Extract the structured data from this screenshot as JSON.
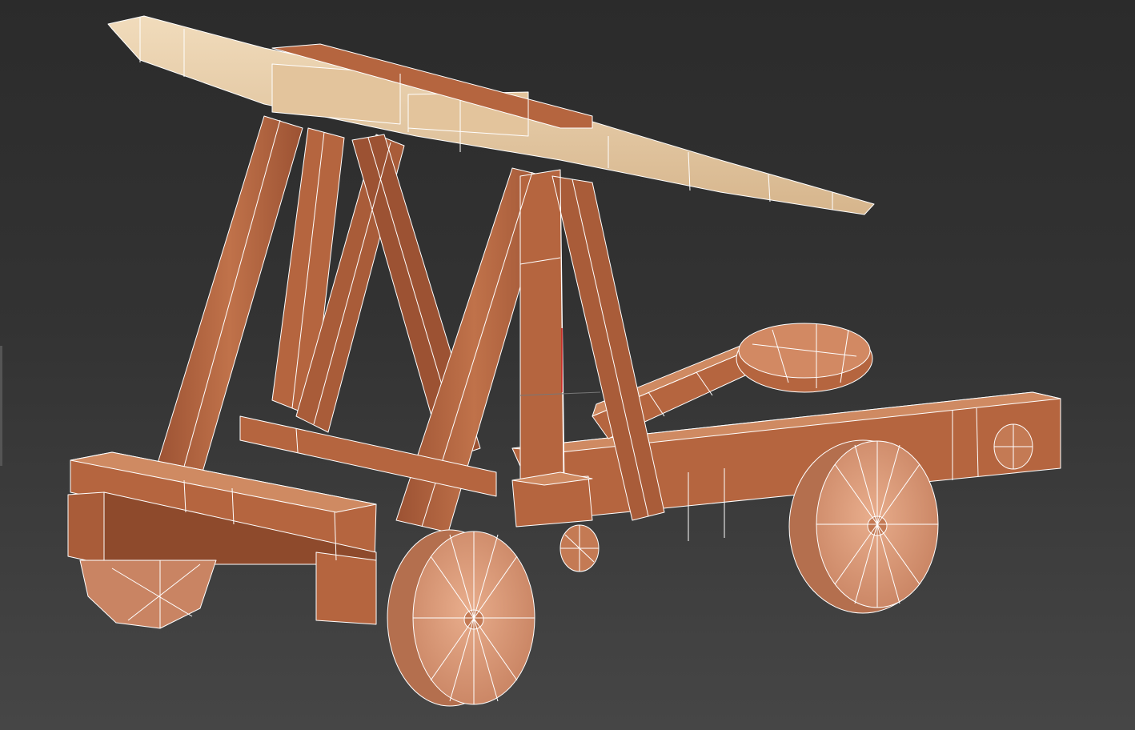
{
  "viewport": {
    "background_top": "#2b2b2b",
    "background_bottom": "#464646",
    "wireframe_color": "#ffffff"
  },
  "model": {
    "wood_color": "#b5653f",
    "wood_dark": "#8e4a2c",
    "wood_light": "#cf8a62",
    "arm_color": "#e8caa2",
    "wheel_color": "#d99a78",
    "wheel_dark": "#b46f4e"
  }
}
